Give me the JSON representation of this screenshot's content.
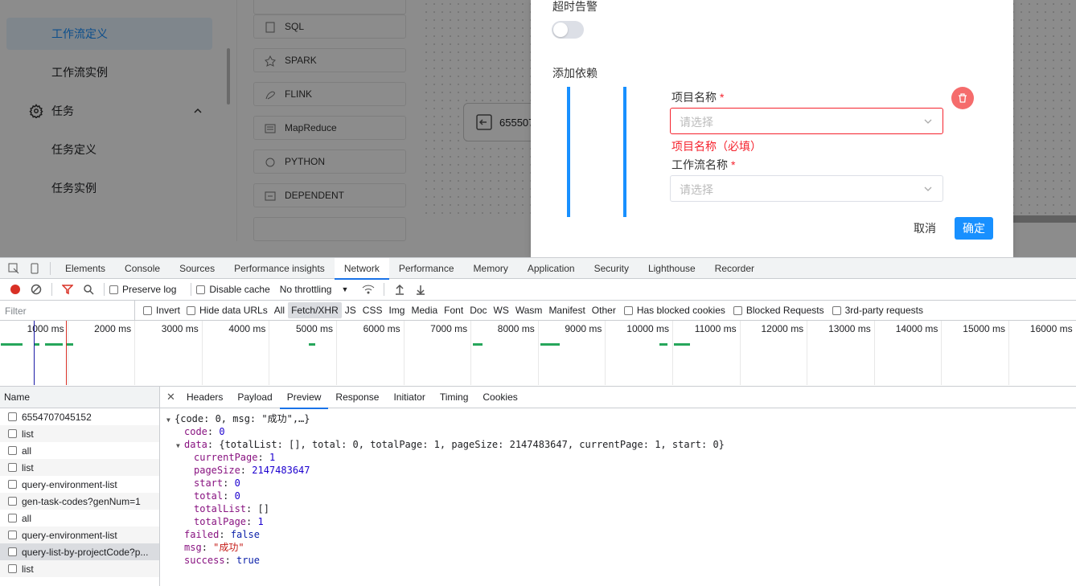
{
  "sidebar": {
    "items": [
      {
        "label": "工作流定义",
        "active": true
      },
      {
        "label": "工作流实例"
      },
      {
        "label": "任务",
        "group": true
      },
      {
        "label": "任务定义"
      },
      {
        "label": "任务实例"
      }
    ]
  },
  "toolbox": [
    "SQL",
    "SPARK",
    "FLINK",
    "MapReduce",
    "PYTHON",
    "DEPENDENT"
  ],
  "canvas": {
    "node_label": "655507"
  },
  "dialog": {
    "timeout_alert_label": "超时告警",
    "add_dependency_label": "添加依赖",
    "project_name_label": "项目名称",
    "required_mark": "*",
    "project_placeholder": "请选择",
    "project_error": "项目名称（必填）",
    "workflow_name_label": "工作流名称",
    "workflow_placeholder": "请选择",
    "cancel_label": "取消",
    "confirm_label": "确定"
  },
  "devtools": {
    "tabs": [
      "Elements",
      "Console",
      "Sources",
      "Performance insights",
      "Network",
      "Performance",
      "Memory",
      "Application",
      "Security",
      "Lighthouse",
      "Recorder"
    ],
    "active_tab": "Network",
    "toolbar": {
      "preserve_log": "Preserve log",
      "disable_cache": "Disable cache",
      "throttling": "No throttling"
    },
    "filter": {
      "placeholder": "Filter",
      "invert": "Invert",
      "hide_data_urls": "Hide data URLs",
      "types": [
        "All",
        "Fetch/XHR",
        "JS",
        "CSS",
        "Img",
        "Media",
        "Font",
        "Doc",
        "WS",
        "Wasm",
        "Manifest",
        "Other"
      ],
      "active_type": "Fetch/XHR",
      "has_blocked_cookies": "Has blocked cookies",
      "blocked_requests": "Blocked Requests",
      "third_party": "3rd-party requests"
    },
    "timeline_ticks": [
      "1000 ms",
      "2000 ms",
      "3000 ms",
      "4000 ms",
      "5000 ms",
      "6000 ms",
      "7000 ms",
      "8000 ms",
      "9000 ms",
      "10000 ms",
      "11000 ms",
      "12000 ms",
      "13000 ms",
      "14000 ms",
      "15000 ms",
      "16000 ms"
    ],
    "name_header": "Name",
    "requests": [
      "6554707045152",
      "list",
      "all",
      "list",
      "query-environment-list",
      "gen-task-codes?genNum=1",
      "all",
      "query-environment-list",
      "query-list-by-projectCode?p...",
      "list"
    ],
    "selected_request_index": 8,
    "detail_tabs": [
      "Headers",
      "Payload",
      "Preview",
      "Response",
      "Initiator",
      "Timing",
      "Cookies"
    ],
    "active_detail_tab": "Preview",
    "preview": {
      "summary": "{code: 0, msg: \"成功\",…}",
      "code_key": "code",
      "code_val": "0",
      "data_key": "data",
      "data_summary": "{totalList: [], total: 0, totalPage: 1, pageSize: 2147483647, currentPage: 1, start: 0}",
      "currentPage_key": "currentPage",
      "currentPage_val": "1",
      "pageSize_key": "pageSize",
      "pageSize_val": "2147483647",
      "start_key": "start",
      "start_val": "0",
      "total_key": "total",
      "total_val": "0",
      "totalList_key": "totalList",
      "totalList_val": "[]",
      "totalPage_key": "totalPage",
      "totalPage_val": "1",
      "failed_key": "failed",
      "failed_val": "false",
      "msg_key": "msg",
      "msg_val": "\"成功\"",
      "success_key": "success",
      "success_val": "true"
    }
  }
}
